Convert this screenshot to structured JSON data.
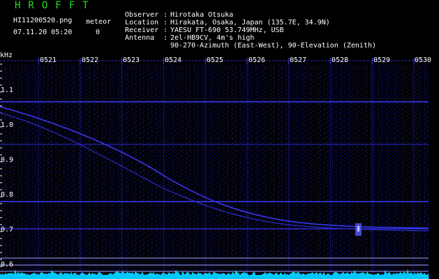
{
  "header": {
    "brand": "HROFFT",
    "filename": "HI11200520.png",
    "meteor_label": "meteor",
    "timestamp": "07.11.20 05:20",
    "meteor_count": "0"
  },
  "info": [
    {
      "key": "Observer",
      "value": "Hirotaka Otsuka"
    },
    {
      "key": "Location",
      "value": "Hirakata, Osaka, Japan (135.7E, 34.9N)"
    },
    {
      "key": "Receiver",
      "value": "YAESU FT-690 53.749MHz, USB"
    },
    {
      "key": "Antenna",
      "value": "2el-HB9CV, 4m's high"
    },
    {
      "key": "",
      "value": "90-270-Azimuth (East-West), 90-Elevation (Zenith)"
    }
  ],
  "axis": {
    "y_unit": "kHz",
    "x_ticks": [
      "0521",
      "0522",
      "0523",
      "0524",
      "0525",
      "0526",
      "0527",
      "0528",
      "0529",
      "0530"
    ],
    "y_ticks": [
      "1.1",
      "1.0",
      "0.9",
      "0.8",
      "0.7",
      "0.6"
    ]
  },
  "colors": {
    "background": "#000000",
    "header_green": "#20e020",
    "text": "#ffffff",
    "trace": "#3a3aff",
    "noise": "#2020c0",
    "baseline": "#00d8ff"
  }
}
